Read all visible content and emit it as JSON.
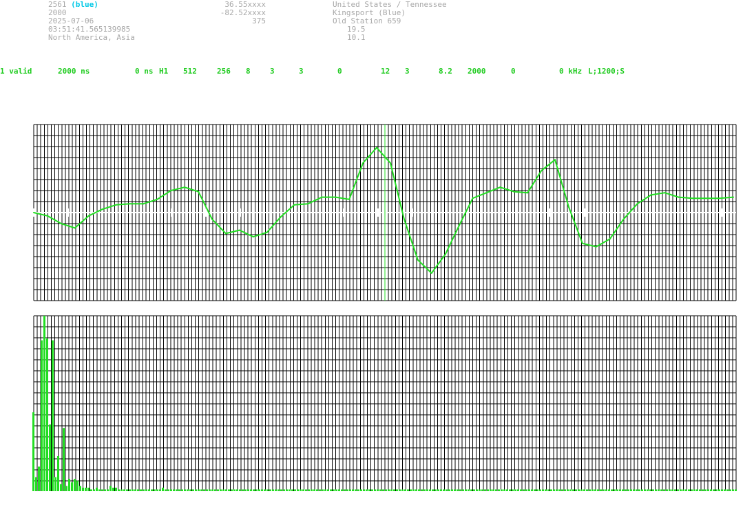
{
  "header": {
    "left": {
      "id": "2561",
      "tag": "(blue)",
      "number": "2000",
      "date": "2025-07-06",
      "time": "03:51:41.565139985",
      "regions": "North America, Asia"
    },
    "middle": {
      "lat": "36.55xxxx",
      "lon": "-82.52xxxx",
      "value": "375"
    },
    "right": {
      "location": "United States / Tennessee",
      "city": "Kingsport (Blue)",
      "station": "Old Station 659",
      "v1": "19.5",
      "v2": "10.1"
    }
  },
  "params": [
    "1 valid",
    "2000 ns",
    "0 ns",
    "H1",
    "512",
    "256",
    "8",
    "3",
    "3",
    "0",
    "12",
    "3",
    "8.2",
    "2000",
    "0",
    "0 kHz",
    "L;1200;S"
  ],
  "colors": {
    "trace": "#22dd22",
    "grid": "#000000",
    "meta_text": "#a8a8a8",
    "tag": "#00c8e6",
    "baseline": "#ffffff"
  },
  "chart_data": [
    {
      "type": "line",
      "title": "",
      "grid": true,
      "marker_at_sample": 256,
      "x": [
        0,
        10,
        20,
        30,
        40,
        50,
        60,
        70,
        80,
        90,
        100,
        110,
        120,
        130,
        140,
        150,
        160,
        170,
        180,
        190,
        200,
        210,
        220,
        230,
        240,
        250,
        260,
        270,
        280,
        290,
        300,
        310,
        320,
        330,
        340,
        350,
        360,
        370,
        380,
        390,
        400,
        410,
        420,
        430,
        440,
        450,
        460,
        470,
        480,
        490,
        500,
        510
      ],
      "values": [
        0,
        -0.3,
        -1,
        -1.4,
        -0.3,
        0.3,
        0.7,
        0.8,
        0.8,
        1.2,
        2,
        2.3,
        1.9,
        -0.6,
        -1.9,
        -1.6,
        -2.2,
        -1.8,
        -0.4,
        0.7,
        0.8,
        1.4,
        1.4,
        1.2,
        4.5,
        5.9,
        4.5,
        -0.6,
        -4.3,
        -5.5,
        -3.8,
        -1.2,
        1.3,
        1.8,
        2.3,
        1.9,
        1.8,
        3.8,
        4.8,
        0.5,
        -2.8,
        -3.1,
        -2.4,
        -0.6,
        0.8,
        1.6,
        1.8,
        1.4,
        1.3,
        1.3,
        1.3,
        1.4
      ],
      "ylim": [
        -8,
        8
      ]
    },
    {
      "type": "bar",
      "title": "",
      "grid": true,
      "values": [
        45,
        8,
        14,
        86,
        100,
        87,
        38,
        86,
        8,
        20,
        4,
        36,
        3,
        7,
        5,
        7,
        6,
        3,
        2,
        2,
        2,
        1,
        1,
        2,
        1,
        1,
        1,
        1,
        3,
        2,
        2,
        1,
        1,
        1,
        1,
        1,
        1,
        1,
        1,
        1,
        1,
        1,
        1,
        1,
        1,
        1,
        1,
        2,
        1,
        1
      ],
      "tail_level": 1,
      "total_bins": 256,
      "ylim": [
        0,
        100
      ]
    }
  ]
}
